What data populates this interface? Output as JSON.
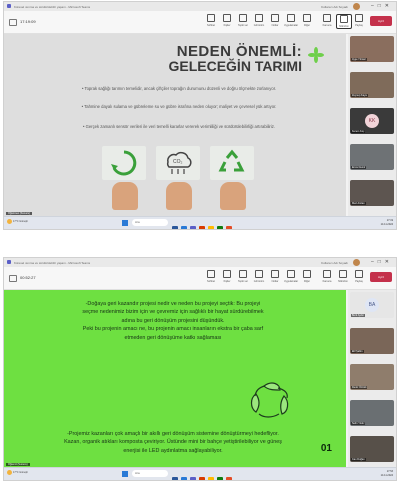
{
  "screens": [
    {
      "titlebar": {
        "title": "Küresel ısınma ve sürdürülebilir yaşam - Microsoft Teams",
        "user": "Kullanıcı Adı Soyadı"
      },
      "toolbar": {
        "timer": "17:19:09",
        "items": [
          "Sohbet",
          "Kişiler",
          "Tepki ver",
          "Görünüm",
          "Notlar",
          "Uygulamalar",
          "Diğer",
          "Kamera",
          "Mikrofon",
          "Paylaş"
        ],
        "leave_label": "Ayrıl"
      },
      "slide": {
        "title_line1": "NEDEN ÖNEMLİ:",
        "title_line2": "GELECEĞİN TARIMI",
        "bullets": [
          "• Toprak sağlığı tarımın temelidir, ancak çiftçiler toprağın durumunu düzenli ve doğru ölçmekte zorlanıyor.",
          "• Tahmine dayalı sulama ve gübreleme su ve gübre israfına neden oluyor; maliyet ve çevresel yük artıyor.",
          "• Gerçek zamanlı sensör verileri ile veri temelli kararlar vererek verimliliği ve sürdürülebilirliği artırabiliriz."
        ],
        "presenter": "Öğretmen (Sunucu)"
      },
      "participants": [
        {
          "name": "Ayşe Yılmaz",
          "initials": ""
        },
        {
          "name": "Zeynep Kaya",
          "initials": ""
        },
        {
          "name": "Kerem Koç",
          "initials": "KK"
        },
        {
          "name": "Emre Demir",
          "initials": ""
        },
        {
          "name": "Mert Arslan",
          "initials": ""
        }
      ],
      "taskbar": {
        "weather_temp": "17°C",
        "weather_desc": "Güneşli",
        "search": "Ara",
        "time": "17:19",
        "date": "14.11.2024"
      }
    },
    {
      "titlebar": {
        "title": "Küresel ısınma ve sürdürülebilir yaşam - Microsoft Teams",
        "user": "Kullanıcı Adı Soyadı"
      },
      "toolbar": {
        "timer": "00:52:27",
        "items": [
          "Sohbet",
          "Kişiler",
          "Tepki ver",
          "Görünüm",
          "Notlar",
          "Uygulamalar",
          "Diğer",
          "Kamera",
          "Mikrofon",
          "Paylaş"
        ],
        "leave_label": "Ayrıl"
      },
      "slide": {
        "para1": [
          "-Doğaya geri kazandır projesi nedir ve neden bu projeyi seçtik: Bu projeyi",
          "seçme nedenimiz bizim için ve çevremiz için sağlıklı bir hayat sürdürebilmek",
          "adına bu geri dönüşüm projesini düşündük.",
          "Peki bu projenin amacı ne, bu projenin amacı insanların ekstra bir çaba sarf",
          "etmeden geri dönüşüme katkı sağlaması"
        ],
        "para2": [
          "-Projemiz kazanları çok amaçlı bir akıllı geri dönüşüm sistemine dönüştürmeyi hedefliyor.",
          "Kazan, organik atıkları komposta çeviriyor. Üstünde mini bir bahçe yetiştirilebiliyor ve güneş",
          "enerjisi ile LED aydınlatma sağlayabiliyor."
        ],
        "page_number": "01",
        "presenter": "Öğrenci (Sunucu)"
      },
      "participants": [
        {
          "name": "Berk Aydın",
          "initials": "BA"
        },
        {
          "name": "Elif Şahin",
          "initials": ""
        },
        {
          "name": "Deniz Öztürk",
          "initials": ""
        },
        {
          "name": "Selin Yıldız",
          "initials": ""
        },
        {
          "name": "Can Doğan",
          "initials": ""
        }
      ],
      "taskbar": {
        "weather_temp": "17°C",
        "weather_desc": "Güneşli",
        "search": "Ara",
        "time": "17:53",
        "date": "14.11.2024"
      }
    }
  ],
  "colors": {
    "teams_purple": "#5b5fc7",
    "leave_red": "#c4314b",
    "slide2_green": "#6ee041",
    "slide1_bg": "#dedede"
  }
}
